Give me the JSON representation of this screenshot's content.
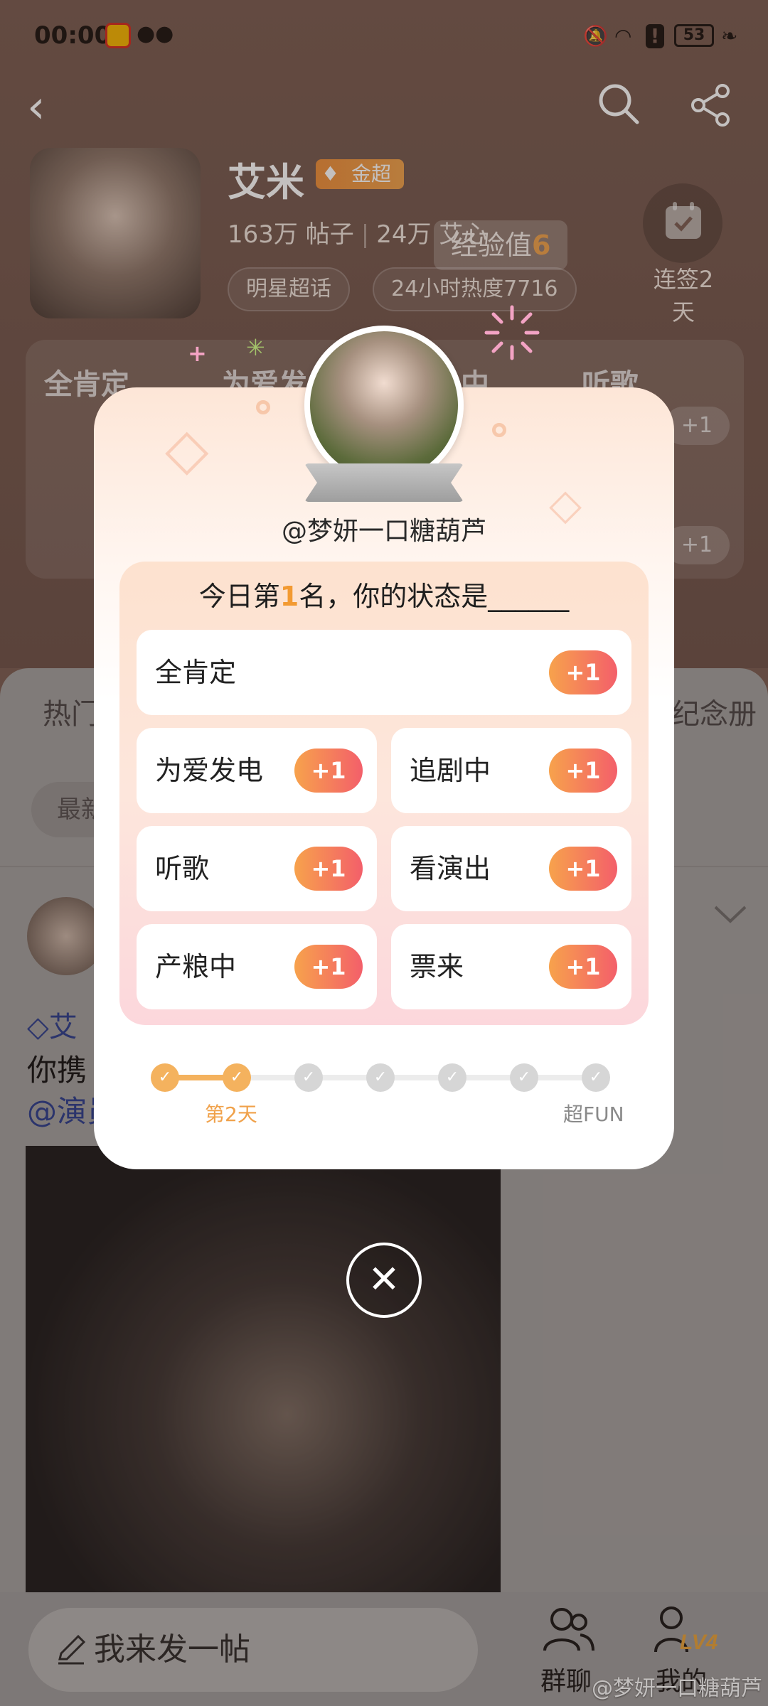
{
  "status_bar": {
    "time": "00:00",
    "battery": "53"
  },
  "profile": {
    "name": "艾米",
    "badge": "金超",
    "posts_count": "163万",
    "posts_label": "帖子",
    "fans_count": "24万",
    "fans_label": "艾心",
    "tags": [
      "明星超话",
      "24小时热度7716"
    ],
    "checkin_label": "连签2天"
  },
  "exp_toast": {
    "label": "经验值",
    "value": "6"
  },
  "background": {
    "status_chips": [
      "全肯定",
      "为爱发",
      "中",
      "听歌"
    ],
    "plus_label": "+1",
    "tabs": [
      "热门",
      "纪念册"
    ],
    "filter_chip": "最新",
    "post_author": "艾",
    "post_text": "你携",
    "post_mention": "@演员",
    "compose_placeholder": "我来发一帖",
    "nav_group": "群聊",
    "nav_me": "我的",
    "level_badge": "LV4",
    "watermark": "@梦妍一口糖葫芦"
  },
  "modal": {
    "username": "@梦妍一口糖葫芦",
    "question_prefix": "今日第",
    "rank": "1",
    "question_suffix": "名，你的状态是______",
    "options": [
      {
        "label": "全肯定",
        "action": "+1"
      },
      {
        "label": "为爱发电",
        "action": "+1"
      },
      {
        "label": "追剧中",
        "action": "+1"
      },
      {
        "label": "听歌",
        "action": "+1"
      },
      {
        "label": "看演出",
        "action": "+1"
      },
      {
        "label": "产粮中",
        "action": "+1"
      },
      {
        "label": "票来",
        "action": "+1"
      }
    ],
    "progress": {
      "total_steps": 7,
      "completed_steps": 2,
      "current_label": "第2天",
      "final_label": "超FUN"
    }
  },
  "colors": {
    "accent_orange": "#f29a32",
    "button_gradient_start": "#f7a24c",
    "button_gradient_end": "#f35f6a",
    "gold_badge": "#ef8f3a"
  }
}
